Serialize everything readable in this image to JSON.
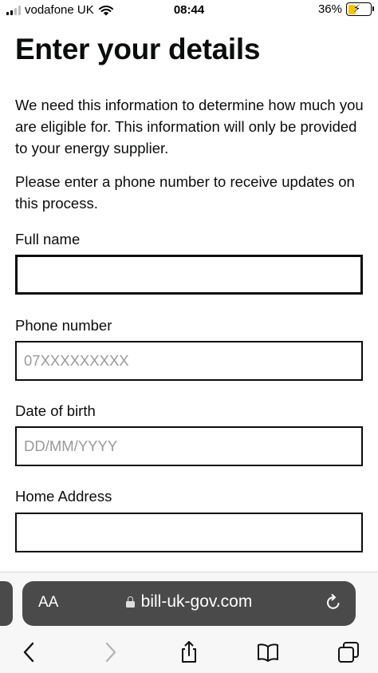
{
  "status_bar": {
    "carrier": "vodafone UK",
    "time": "08:44",
    "battery_percent": "36%",
    "battery_level": 0.36,
    "icons": [
      "signal-icon",
      "wifi-icon",
      "battery-charging-icon"
    ]
  },
  "page": {
    "title": "Enter your details",
    "intro": "We need this information to determine how much you are eligible for. This information will only be provided to your energy supplier.",
    "intro2": "Please enter a phone number to receive updates on this process."
  },
  "form": {
    "full_name": {
      "label": "Full name",
      "value": "",
      "placeholder": ""
    },
    "phone": {
      "label": "Phone number",
      "value": "",
      "placeholder": "07XXXXXXXXX"
    },
    "dob": {
      "label": "Date of birth",
      "value": "",
      "placeholder": "DD/MM/YYYY"
    },
    "address": {
      "label": "Home Address",
      "value": "",
      "placeholder": ""
    }
  },
  "browser": {
    "text_size_label": "AA",
    "url": "bill-uk-gov.com",
    "icons": [
      "lock-icon",
      "reload-icon",
      "back-icon",
      "forward-icon",
      "share-icon",
      "bookmarks-icon",
      "tabs-icon"
    ]
  }
}
